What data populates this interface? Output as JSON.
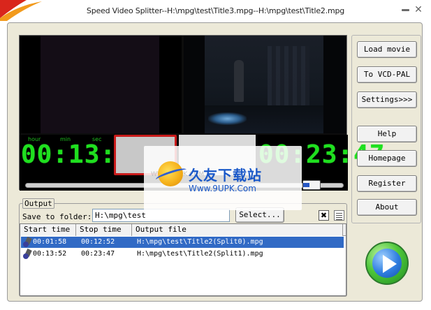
{
  "window": {
    "title": "Speed Video Splitter--H:\\mpg\\test\\Title3.mpg--H:\\mpg\\test\\Title2.mpg",
    "minimize_icon": "minimize-icon",
    "close_icon": "close-icon",
    "close_glyph": "✕"
  },
  "player": {
    "left_time": {
      "hour_label": "hour",
      "min_label": "min",
      "sec_label": "sec",
      "value": "00:13:52"
    },
    "right_time": {
      "value": "00:23:47"
    },
    "slider_value_fraction": 0.89
  },
  "watermark": {
    "faint_text": "WWW.9UPK.COM",
    "cn_text": "久友下载站",
    "url": "Www.9UPK.Com"
  },
  "side_buttons": {
    "load_movie": "Load movie",
    "to_vcd": "To VCD-PAL",
    "settings": "Settings>>>",
    "help": "Help",
    "homepage": "Homepage",
    "register": "Register",
    "about": "About"
  },
  "output": {
    "legend": "Output",
    "save_label": "Save to folder:",
    "folder_value": "H:\\mpg\\test",
    "select_button": "Select...",
    "delete_icon": "delete-icon",
    "delete_glyph": "✖",
    "list_icon": "list-icon",
    "columns": [
      "Start time",
      "Stop time",
      "Output file"
    ],
    "rows": [
      {
        "start": "00:01:58",
        "stop": "00:12:52",
        "file": "H:\\mpg\\test\\Title2(Split0).mpg",
        "selected": true
      },
      {
        "start": "00:13:52",
        "stop": "00:23:47",
        "file": "H:\\mpg\\test\\Title2(Split1).mpg",
        "selected": false
      }
    ]
  },
  "play_button": {
    "icon": "play-icon"
  },
  "colors": {
    "panel": "#ece9d8",
    "digits": "#1fe01f",
    "selection": "#316ac5",
    "split_border": "#c91b1b"
  }
}
